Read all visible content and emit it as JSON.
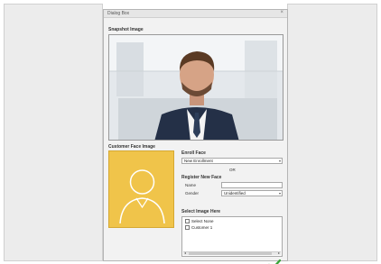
{
  "dialog": {
    "title": "Dialog Box",
    "close_glyph": "×"
  },
  "snapshot": {
    "label": "Snapshot Image"
  },
  "face": {
    "label": "Customer Face Image",
    "icon": "user-avatar-icon",
    "bg_color": "#f0c44a"
  },
  "enroll": {
    "label": "Enroll Face",
    "select_value": "New Enrollment",
    "or_text": "OR",
    "register_label": "Register New Face",
    "name_label": "Name",
    "name_value": "",
    "gender_label": "Gender",
    "gender_value": "Unidentified"
  },
  "select_images": {
    "label": "Select Image Here",
    "items": [
      {
        "label": "Select None",
        "checked": false
      },
      {
        "label": "Customer 1",
        "checked": false
      }
    ]
  },
  "confirm": {
    "icon": "checkmark-icon",
    "color": "#3aa53a"
  }
}
